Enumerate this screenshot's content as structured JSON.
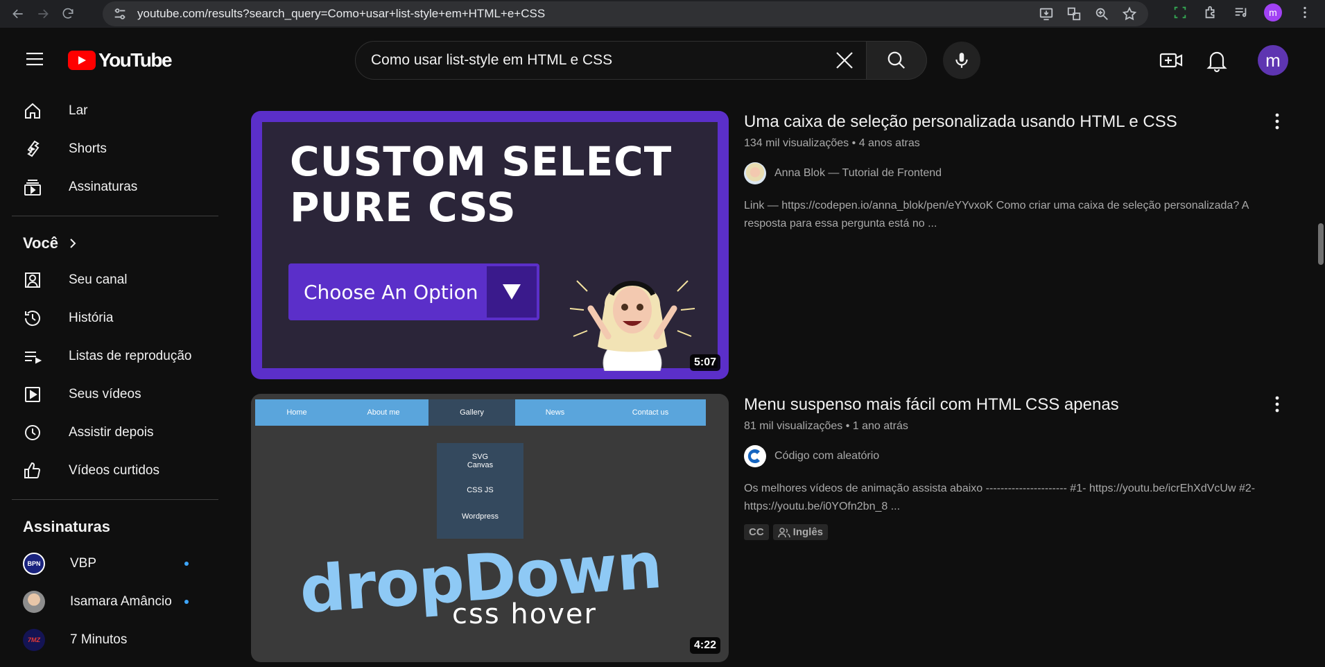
{
  "browser": {
    "url": "youtube.com/results?search_query=Como+usar+list-style+em+HTML+e+CSS",
    "profile_initial": "m"
  },
  "header": {
    "logo_text": "YouTube",
    "search_value": "Como usar list-style em HTML e CSS",
    "avatar_initial": "m"
  },
  "sidebar": {
    "main": [
      {
        "label": "Lar",
        "icon": "home-icon"
      },
      {
        "label": "Shorts",
        "icon": "shorts-icon"
      },
      {
        "label": "Assinaturas",
        "icon": "subscriptions-icon"
      }
    ],
    "you_heading": "Você",
    "you": [
      {
        "label": "Seu canal",
        "icon": "channel-icon"
      },
      {
        "label": "História",
        "icon": "history-icon"
      },
      {
        "label": "Listas de reprodução",
        "icon": "playlist-icon"
      },
      {
        "label": "Seus vídeos",
        "icon": "your-videos-icon"
      },
      {
        "label": "Assistir depois",
        "icon": "watch-later-icon"
      },
      {
        "label": "Vídeos curtidos",
        "icon": "liked-icon"
      }
    ],
    "subs_heading": "Assinaturas",
    "subs": [
      {
        "label": "VBP",
        "avatar_text": "BPN",
        "new": true,
        "color": "#1a237e"
      },
      {
        "label": "Isamara Amâncio",
        "avatar_text": "",
        "new": true,
        "color": "#9e9e9e"
      },
      {
        "label": "7 Minutos",
        "avatar_text": "7MZ",
        "new": false,
        "color": "#1a1a60"
      }
    ]
  },
  "results": [
    {
      "title": "Uma caixa de seleção personalizada usando HTML e CSS",
      "views": "134 mil visualizações",
      "age": "4 anos atras",
      "channel": "Anna Blok — Tutorial de Frontend",
      "description": "Link — https://codepen.io/anna_blok/pen/eYYvxoK Como criar uma caixa de seleção personalizada? A resposta para essa pergunta está no ...",
      "duration": "5:07",
      "thumb": {
        "line1": "CUSTOM SELECT",
        "line2": "PURE CSS",
        "select_label": "Choose An Option",
        "frame_color": "#5b2fc9"
      }
    },
    {
      "title": "Menu suspenso mais fácil com HTML CSS apenas",
      "views": "81 mil visualizações",
      "age": "1 ano atrás",
      "channel": "Código com aleatório",
      "description": "Os melhores vídeos de animação assista abaixo ---------------------- #1- https://youtu.be/icrEhXdVcUw #2- https://youtu.be/i0YOfn2bn_8 ...",
      "duration": "4:22",
      "badges": [
        "CC",
        "Inglês"
      ],
      "thumb": {
        "nav": [
          "Home",
          "About me",
          "Gallery",
          "News",
          "Contact us"
        ],
        "dropdown": [
          "SVG",
          "Canvas",
          "CSS JS",
          "Wordpress"
        ],
        "big_text": "dropDown",
        "sub_text": "css hover"
      }
    }
  ]
}
